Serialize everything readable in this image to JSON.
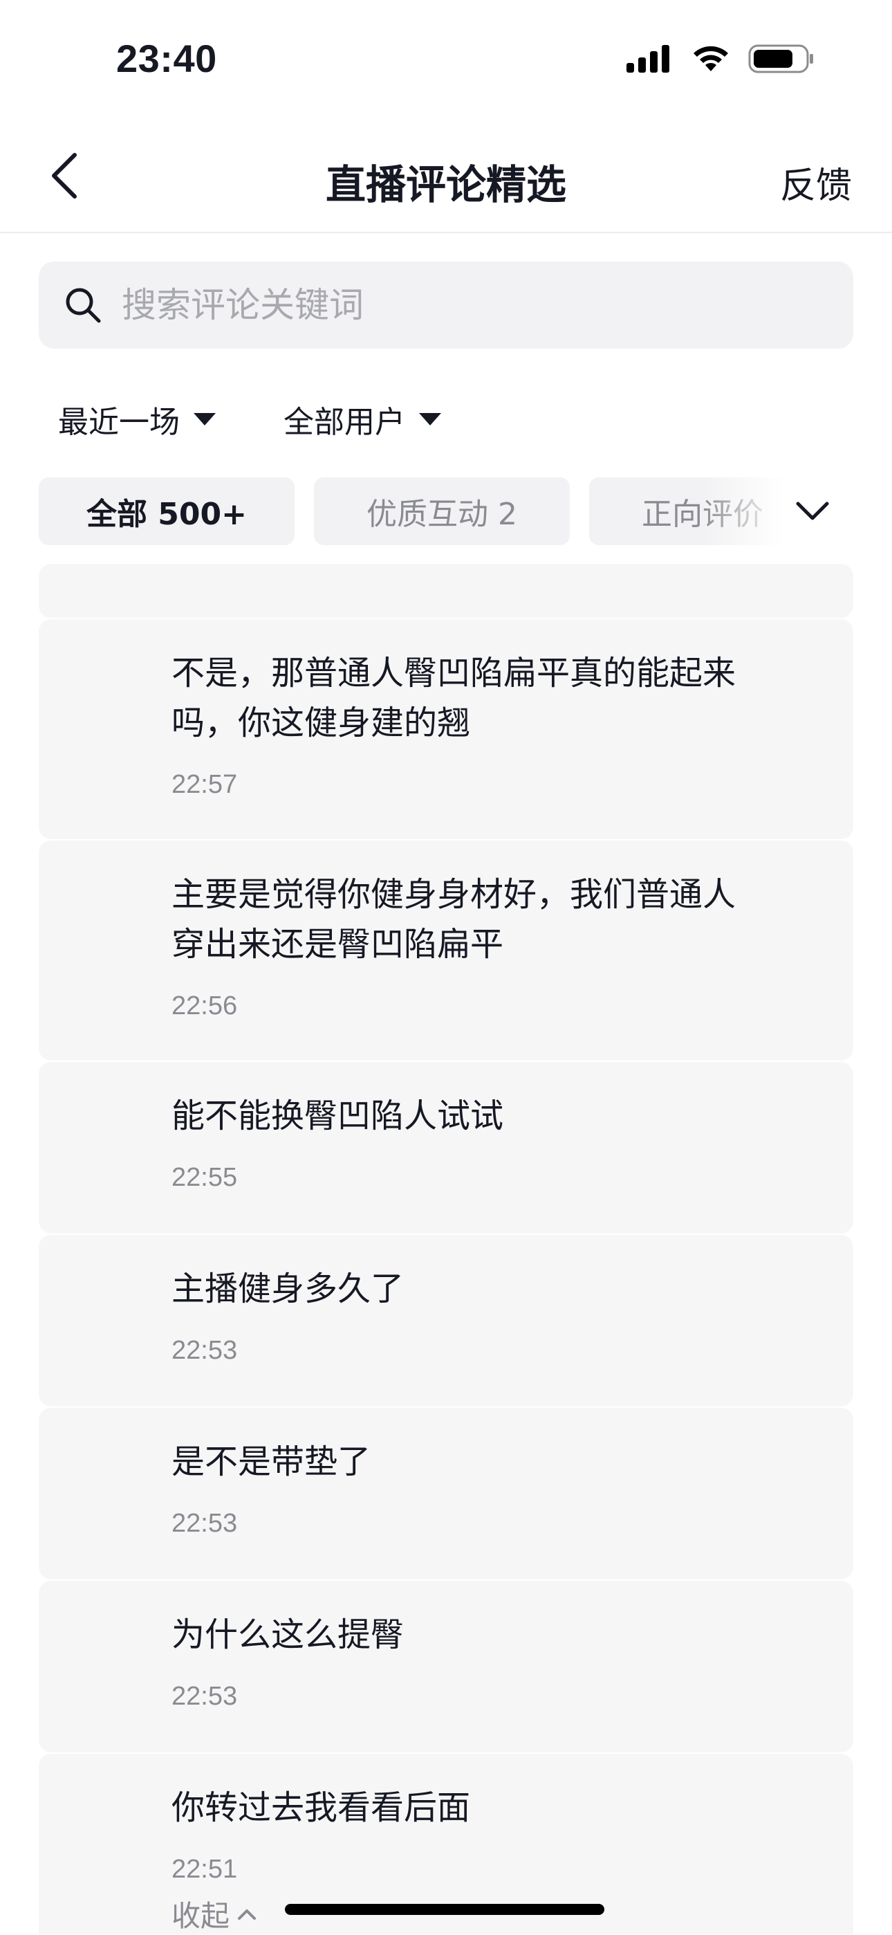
{
  "status_bar": {
    "time": "23:40",
    "icons": [
      "signal-icon",
      "wifi-icon",
      "battery-icon"
    ]
  },
  "header": {
    "back_icon": "chevron-left-icon",
    "title": "直播评论精选",
    "feedback_label": "反馈"
  },
  "search": {
    "icon": "search-icon",
    "value": "",
    "placeholder": "搜索评论关键词"
  },
  "filters": [
    {
      "label": "最近一场",
      "icon": "caret-down-icon"
    },
    {
      "label": "全部用户",
      "icon": "caret-down-icon"
    }
  ],
  "tabs": [
    {
      "label": "全部 500+",
      "active": true
    },
    {
      "label": "优质互动 2",
      "active": false
    },
    {
      "label": "正向评价",
      "active": false
    }
  ],
  "tabs_expand_icon": "chevron-down-icon",
  "comments": [
    {
      "text": "不是，那普通人臀凹陷扁平真的能起来吗，你这健身建的翘",
      "time": "22:57"
    },
    {
      "text": "主要是觉得你健身身材好，我们普通人穿出来还是臀凹陷扁平",
      "time": "22:56"
    },
    {
      "text": "能不能换臀凹陷人试试",
      "time": "22:55"
    },
    {
      "text": "主播健身多久了",
      "time": "22:53"
    },
    {
      "text": "是不是带垫了",
      "time": "22:53"
    },
    {
      "text": "为什么这么提臀",
      "time": "22:53"
    },
    {
      "text": "你转过去我看看后面",
      "time": "22:51"
    }
  ],
  "collapse": {
    "label": "收起",
    "icon": "chevron-up-icon"
  },
  "colors": {
    "text_primary": "#161823",
    "text_secondary": "#8a8b91",
    "card_background": "#f6f6f7",
    "search_background": "#f2f2f4"
  }
}
